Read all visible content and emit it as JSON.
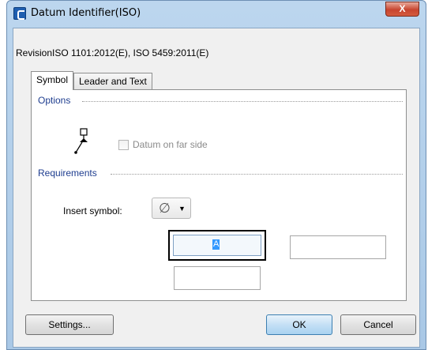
{
  "window": {
    "title": "Datum Identifier(ISO)",
    "close_label": "X"
  },
  "revision_text": "RevisionISO 1101:2012(E), ISO 5459:2011(E)",
  "tabs": [
    {
      "label": "Symbol",
      "active": true
    },
    {
      "label": "Leader and Text",
      "active": false
    }
  ],
  "options": {
    "label": "Options",
    "datum_far_side": {
      "label": "Datum on far side",
      "checked": false,
      "enabled": false
    }
  },
  "requirements": {
    "label": "Requirements",
    "insert_symbol_label": "Insert symbol:",
    "symbol_value": "∅",
    "frame_text": "A"
  },
  "buttons": {
    "settings": "Settings...",
    "ok": "OK",
    "cancel": "Cancel"
  },
  "colors": {
    "accent": "#3399ff",
    "group_label": "#1e3d8f",
    "close": "#c7452f"
  }
}
